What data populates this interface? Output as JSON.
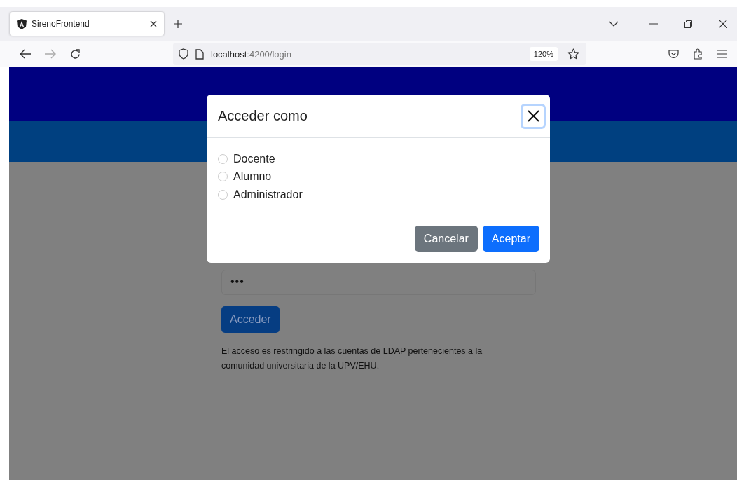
{
  "browser": {
    "tab": {
      "title": "SirenoFrontend",
      "selected": true
    },
    "address": {
      "host": "localhost",
      "path": ":4200/login"
    },
    "zoom": "120%"
  },
  "page": {
    "password": {
      "value": "•••"
    },
    "submit": "Acceder",
    "notice": "El acceso es restringido a las cuentas de LDAP pertenecientes a la comunidad universitaria de la UPV/EHU."
  },
  "dialog": {
    "title": "Acceder como",
    "options": [
      {
        "label": "Docente",
        "selected": false
      },
      {
        "label": "Alumno",
        "selected": false
      },
      {
        "label": "Administrador",
        "selected": false
      }
    ],
    "buttons": [
      {
        "label": "Cancelar",
        "kind": "secondary"
      },
      {
        "label": "Aceptar",
        "kind": "primary"
      }
    ]
  }
}
